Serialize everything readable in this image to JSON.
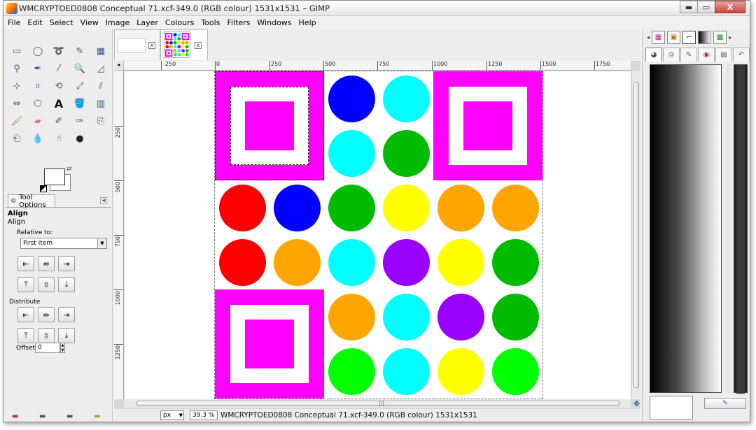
{
  "window": {
    "title": "WMCRYPTOED0808 Conceptual 71.xcf-349.0 (RGB colour) 1531x1531 – GIMP",
    "minimize": "▬",
    "maximize": "▭",
    "close": "X"
  },
  "menu": [
    "File",
    "Edit",
    "Select",
    "View",
    "Image",
    "Layer",
    "Colours",
    "Tools",
    "Filters",
    "Windows",
    "Help"
  ],
  "tool_options": {
    "tab_label": "Tool Options",
    "heading": "Align",
    "subheading": "Align",
    "relative_label": "Relative to:",
    "relative_value": "First item",
    "distribute_label": "Distribute",
    "offset_label": "Offset:",
    "offset_value": "0"
  },
  "rulers": {
    "h_labels": [
      "-250",
      "0",
      "250",
      "500",
      "750",
      "1000",
      "1250",
      "1500",
      "1750"
    ],
    "v_labels": [
      "250",
      "500",
      "750",
      "1000",
      "1250"
    ]
  },
  "status": {
    "unit": "px",
    "zoom": "39.3 %",
    "text": "WMCRYPTOED0808 Conceptual 71.xcf-349.0 (RGB colour) 1531x1531"
  },
  "colors": {
    "magenta": "#ff00ff",
    "blue": "#0000ff",
    "cyan": "#00ffff",
    "green": "#00bb00",
    "lime": "#00ff00",
    "red": "#ff0000",
    "yellow": "#ffff00",
    "orange": "#ffa500",
    "purple": "#9900ff"
  },
  "canvas": {
    "squares": [
      "magenta",
      "magenta",
      "magenta"
    ],
    "circles": [
      "blue",
      "cyan",
      "cyan",
      "green",
      "red",
      "blue",
      "green",
      "yellow",
      "orange",
      "orange",
      "red",
      "orange",
      "cyan",
      "purple",
      "yellow",
      "green",
      "orange",
      "cyan",
      "purple",
      "green",
      "lime",
      "cyan",
      "yellow",
      "lime"
    ]
  }
}
